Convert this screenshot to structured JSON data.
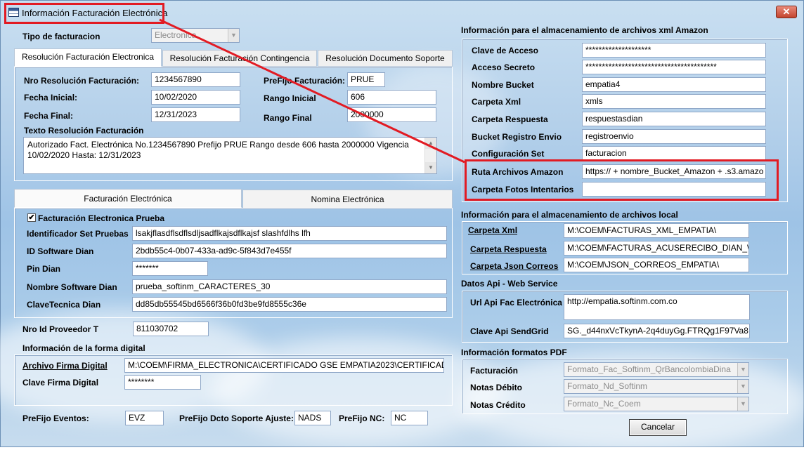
{
  "window": {
    "title": "Información Facturación Electrónica",
    "close_glyph": "✕"
  },
  "left": {
    "tipo": {
      "label": "Tipo de facturacion",
      "value": "Electronica"
    },
    "tabs_top": [
      "Resolución Facturación Electronica",
      "Resolución Facturación Contingencia",
      "Resolución Documento Soporte"
    ],
    "res": {
      "nro_label": "Nro Resolución Facturación:",
      "nro_value": "1234567890",
      "prefijo_label": "PreFijo Facturación:",
      "prefijo_value": "PRUE",
      "fi_label": "Fecha Inicial:",
      "fi_value": "10/02/2020",
      "ri_label": "Rango Inicial",
      "ri_value": "606",
      "ff_label": "Fecha Final:",
      "ff_value": "12/31/2023",
      "rf_label": "Rango Final",
      "rf_value": "2000000",
      "texto_label": "Texto Resolución Facturación",
      "texto_value": "Autorizado Fact. Electrónica No.1234567890 Prefijo PRUE Rango desde 606 hasta 2000000 Vigencia 10/02/2020 Hasta: 12/31/2023"
    },
    "tabs_bottom": [
      "Facturación Electrónica",
      "Nomina Electrónica"
    ],
    "fe": {
      "prueba_label": "Facturación Electronica Prueba",
      "prueba_checked": "✔",
      "set_label": "Identificador Set Pruebas",
      "set_value": "lsakjflasdflsdflsdljsadflkajsdflkajsf slashfdlhs lfh",
      "sw_label": "ID Software Dian",
      "sw_value": "2bdb55c4-0b07-433a-ad9c-5f843d7e455f",
      "pin_label": "Pin Dian",
      "pin_value": "*******",
      "nombre_label": "Nombre Software Dian",
      "nombre_value": "prueba_softinm_CARACTERES_30",
      "clave_label": "ClaveTecnica Dian",
      "clave_value": "dd85db55545bd6566f36b0fd3be9fd8555c36e"
    },
    "proveedor": {
      "label": "Nro Id Proveedor T",
      "value": "811030702"
    },
    "firma": {
      "section": "Información de la forma digital",
      "archivo_label": "Archivo Firma Digital",
      "archivo_value": "M:\\COEM\\FIRMA_ELECTRONICA\\CERTIFICADO GSE EMPATIA2023\\CERTIFICAD",
      "clave_label": "Clave Firma Digital",
      "clave_value": "********"
    },
    "prefijos": {
      "eventos_label": "PreFijo Eventos:",
      "eventos_value": "EVZ",
      "ajuste_label": "PreFijo Dcto Soporte Ajuste:",
      "ajuste_value": "NADS",
      "nc_label": "PreFijo NC:",
      "nc_value": "NC"
    }
  },
  "right": {
    "amazon": {
      "section": "Información para el almacenamiento de archivos xml Amazon",
      "rows": [
        {
          "label": "Clave de Acceso",
          "value": "********************"
        },
        {
          "label": "Acceso Secreto",
          "value": "****************************************"
        },
        {
          "label": "Nombre Bucket",
          "value": "empatia4"
        },
        {
          "label": "Carpeta Xml",
          "value": "xmls"
        },
        {
          "label": "Carpeta Respuesta",
          "value": "respuestasdian"
        },
        {
          "label": "Bucket Registro Envio",
          "value": "registroenvio"
        },
        {
          "label": "Configuración Set",
          "value": "facturacion"
        },
        {
          "label": "Ruta Archivos Amazon",
          "value": "https:// + nombre_Bucket_Amazon + .s3.amazo"
        },
        {
          "label": "Carpeta Fotos Intentarios",
          "value": ""
        }
      ]
    },
    "local": {
      "section": "Información para el almacenamiento de archivos local",
      "xml_label": "Carpeta Xml",
      "xml_value": "M:\\COEM\\FACTURAS_XML_EMPATIA\\",
      "resp_label": "Carpeta Respuesta",
      "resp_value": "M:\\COEM\\FACTURAS_ACUSERECIBO_DIAN_\\",
      "json_label": "Carpeta Json Correos",
      "json_value": "M:\\COEM\\JSON_CORREOS_EMPATIA\\"
    },
    "api": {
      "section": "Datos Api - Web Service",
      "url_label": "Url Api Fac Electrónica",
      "url_value": "http://empatia.softinm.com.co",
      "sg_label": "Clave Api SendGrid",
      "sg_value": "SG._d44nxVcTkynA-2q4duyGg.FTRQg1F97Va8"
    },
    "pdf": {
      "section": "Información formatos PDF",
      "fac_label": "Facturación",
      "fac_value": "Formato_Fac_Softinm_QrBancolombiaDina",
      "nd_label": "Notas Débito",
      "nd_value": "Formato_Nd_Softinm",
      "nc_label": "Notas Crédito",
      "nc_value": "Formato_Nc_Coem"
    },
    "cancel": "Cancelar"
  },
  "colors": {
    "highlight": "#e21b23",
    "background": "#a9cbe9"
  }
}
